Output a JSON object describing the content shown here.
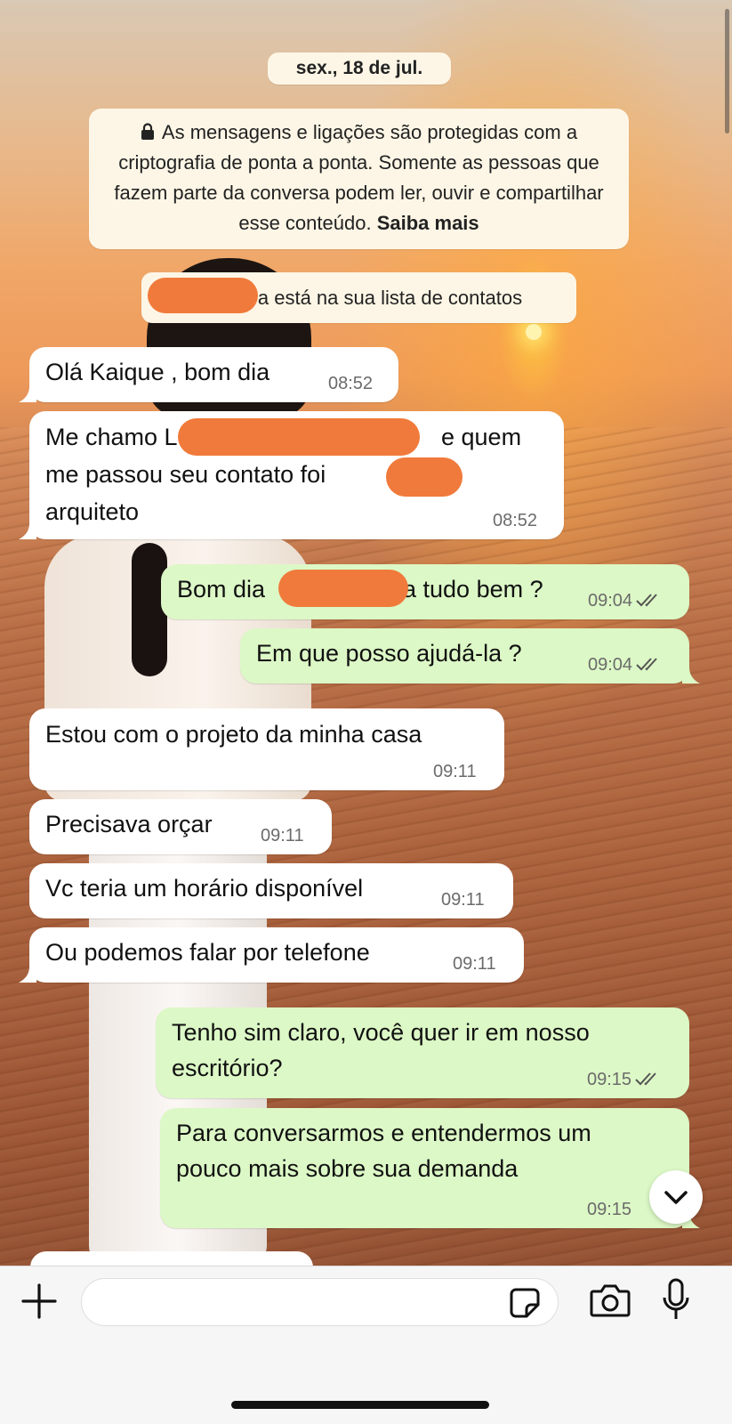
{
  "chat": {
    "date_label": "sex., 18 de jul.",
    "encryption_notice": {
      "text": "As mensagens e ligações são protegidas com a criptografia de ponta a ponta. Somente as pessoas que fazem parte da conversa podem ler, ouvir e compartilhar esse conteúdo.",
      "link": "Saiba mais"
    },
    "contact_notice": "a está na sua lista de contatos",
    "messages": [
      {
        "dir": "in",
        "lines": [
          "Olá Kaique , bom dia"
        ],
        "time": "08:52"
      },
      {
        "dir": "in",
        "lines": [
          "Me chamo L",
          "me passou seu contato foi",
          "arquiteto"
        ],
        "extra": "e quem",
        "time": "08:52"
      },
      {
        "dir": "out",
        "lines": [
          "Bom dia",
          "a tudo bem ?"
        ],
        "time": "09:04",
        "status": "read"
      },
      {
        "dir": "out",
        "lines": [
          "Em que posso ajudá-la ?"
        ],
        "time": "09:04",
        "status": "read"
      },
      {
        "dir": "in",
        "lines": [
          "Estou com o projeto da minha casa"
        ],
        "time": "09:11"
      },
      {
        "dir": "in",
        "lines": [
          "Precisava orçar"
        ],
        "time": "09:11"
      },
      {
        "dir": "in",
        "lines": [
          "Vc teria um horário disponível"
        ],
        "time": "09:11"
      },
      {
        "dir": "in",
        "lines": [
          "Ou podemos falar por telefone"
        ],
        "time": "09:11"
      },
      {
        "dir": "out",
        "lines": [
          "Tenho sim claro, você quer ir em nosso",
          "escritório?"
        ],
        "time": "09:15",
        "status": "read"
      },
      {
        "dir": "out",
        "lines": [
          "Para conversarmos e entendermos um",
          "pouco mais sobre sua demanda"
        ],
        "time": "09:15",
        "status": "read"
      }
    ]
  },
  "composer": {
    "value": "",
    "icons": [
      "plus-icon",
      "sticker-icon",
      "camera-icon",
      "microphone-icon"
    ]
  },
  "colors": {
    "incoming_bubble": "#ffffff",
    "outgoing_bubble": "#dcf8c6",
    "system_pill": "#fdf6e6",
    "redaction": "#f07a3b"
  }
}
